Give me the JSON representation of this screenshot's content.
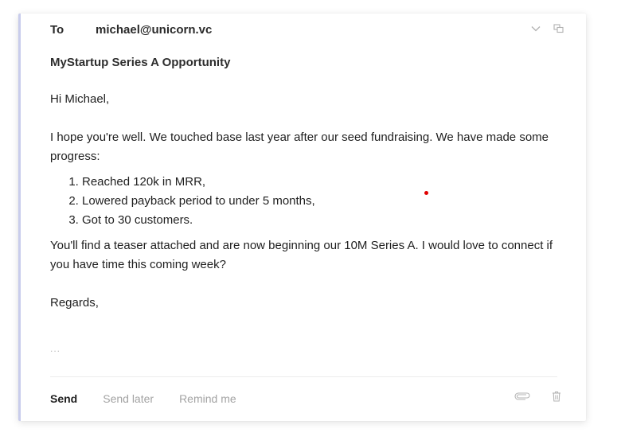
{
  "compose": {
    "to_label": "To",
    "to_value": "michael@unicorn.vc",
    "subject": "MyStartup Series A Opportunity",
    "greeting": "Hi Michael,",
    "paragraph1": "I hope you're well. We touched base last year after our seed fundraising. We have made some progress:",
    "list": [
      "Reached 120k in MRR,",
      "Lowered payback period to under 5 months,",
      "Got to 30 customers."
    ],
    "paragraph2": "You'll find a teaser attached and are now beginning our 10M Series A. I would love to connect if you have time this coming week?",
    "signoff": "Regards,",
    "ellipsis": "...",
    "icons": {
      "collapse": "chevron-down-icon",
      "popout": "popout-window-icon",
      "attach": "paperclip-icon",
      "delete": "trash-icon"
    }
  },
  "footer": {
    "send": "Send",
    "send_later": "Send later",
    "remind_me": "Remind me"
  },
  "colors": {
    "accent_border": "#c9cdec",
    "muted_text": "#a3a3a3",
    "cursor_dot": "#e00000"
  }
}
